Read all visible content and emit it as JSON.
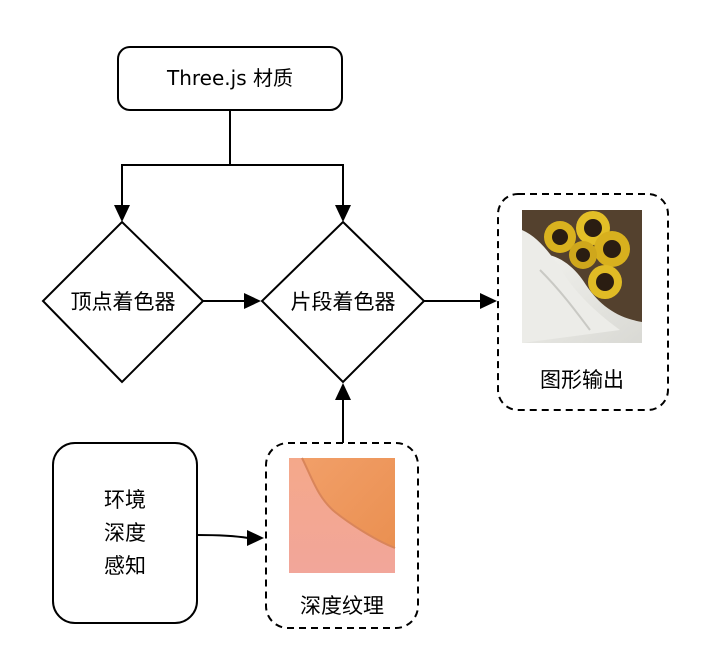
{
  "diagram": {
    "nodes": {
      "material": {
        "label": "Three.js 材质"
      },
      "vertex_shader": {
        "label": "顶点着色器"
      },
      "fragment_shader": {
        "label": "片段着色器"
      },
      "output": {
        "label": "图形输出",
        "image": "photo-of-yellow-flower-toys-on-white-fabric"
      },
      "env_depth": {
        "lines": [
          "环境",
          "深度",
          "感知"
        ]
      },
      "depth_texture": {
        "label": "深度纹理",
        "image": "orange-depth-map-texture"
      }
    },
    "edges": [
      {
        "from": "material",
        "to": "vertex_shader"
      },
      {
        "from": "material",
        "to": "fragment_shader"
      },
      {
        "from": "vertex_shader",
        "to": "fragment_shader"
      },
      {
        "from": "fragment_shader",
        "to": "output"
      },
      {
        "from": "env_depth",
        "to": "depth_texture"
      },
      {
        "from": "depth_texture",
        "to": "fragment_shader"
      }
    ]
  }
}
